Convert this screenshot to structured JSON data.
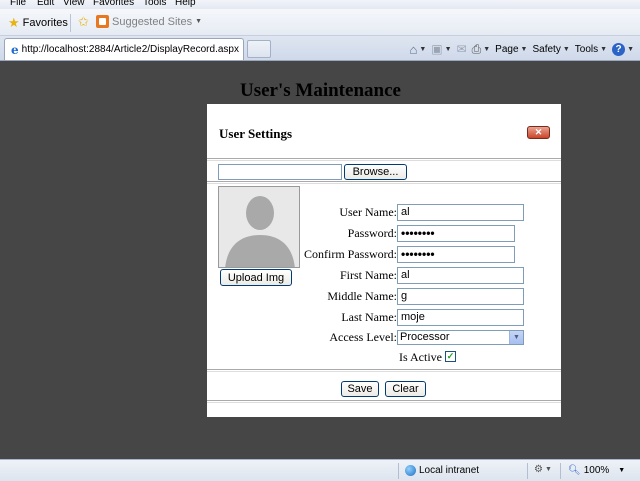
{
  "browser": {
    "menu": [
      "File",
      "Edit",
      "View",
      "Favorites",
      "Tools",
      "Help"
    ],
    "favorites_label": "Favorites",
    "suggested_sites_label": "Suggested Sites",
    "tab_url": "http://localhost:2884/Article2/DisplayRecord.aspx",
    "commands": {
      "page": "Page",
      "safety": "Safety",
      "tools": "Tools"
    }
  },
  "page": {
    "title": "User's Maintenance"
  },
  "dialog": {
    "title": "User Settings",
    "close_label": "✕",
    "browse_label": "Browse...",
    "file_path": "",
    "upload_label": "Upload Img",
    "fields": {
      "user_name": {
        "label": "User Name:",
        "value": "al"
      },
      "password": {
        "label": "Password:",
        "value": "••••••••"
      },
      "confirm_password": {
        "label": "Confirm Password:",
        "value": "••••••••"
      },
      "first_name": {
        "label": "First Name:",
        "value": "al"
      },
      "middle_name": {
        "label": "Middle Name:",
        "value": "g"
      },
      "last_name": {
        "label": "Last Name:",
        "value": "moje"
      },
      "access_level": {
        "label": "Access Level:",
        "value": "Processor"
      }
    },
    "is_active": {
      "label": "Is Active",
      "checked": true
    },
    "save_label": "Save",
    "clear_label": "Clear"
  },
  "statusbar": {
    "zone": "Local intranet",
    "zoom": "100%"
  }
}
